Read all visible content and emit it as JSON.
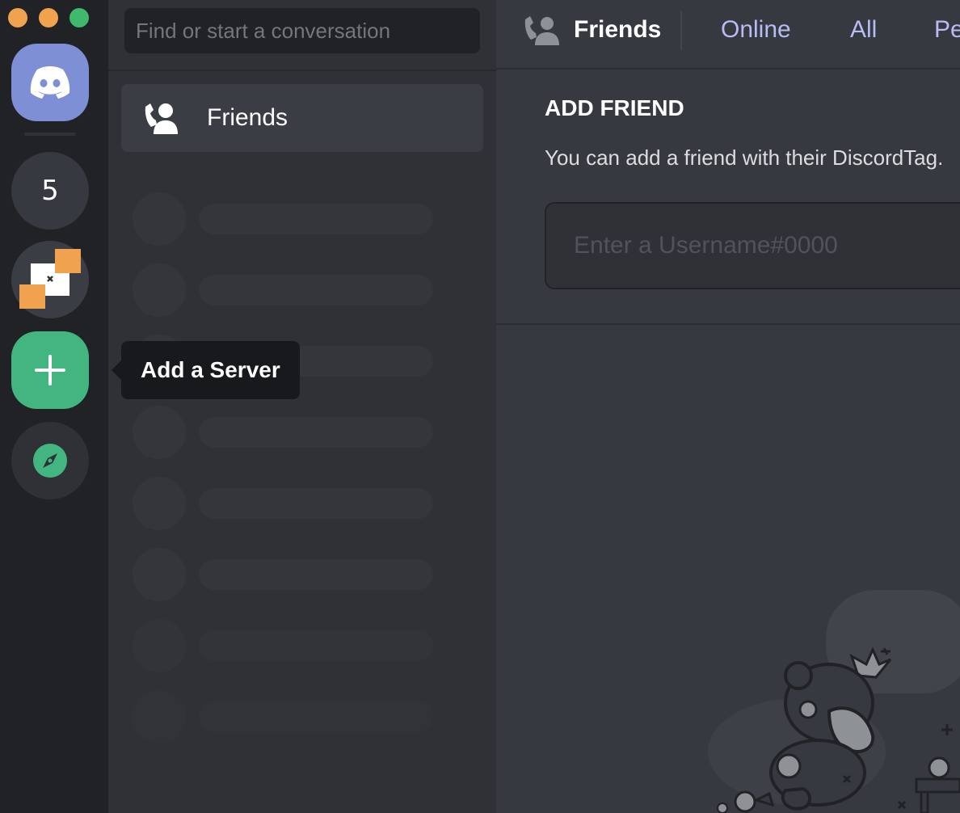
{
  "window": {
    "controls": [
      "close",
      "minimize",
      "zoom"
    ]
  },
  "server_rail": {
    "home_icon": "discord-logo-icon",
    "unread_count": "5",
    "tooltip": "Add a Server"
  },
  "sidebar": {
    "search_placeholder": "Find or start a conversation",
    "friends_label": "Friends"
  },
  "header": {
    "title": "Friends",
    "tabs": [
      "Online",
      "All",
      "Pe"
    ]
  },
  "add_friend": {
    "title": "ADD FRIEND",
    "description": "You can add a friend with their DiscordTag.",
    "input_placeholder": "Enter a Username#0000"
  },
  "colors": {
    "rail_bg": "#202225",
    "sidebar_bg": "#2f3136",
    "main_bg": "#36393f",
    "blurple": "#7f8fd6",
    "green": "#43b581",
    "traffic_orange": "#f0a24f",
    "traffic_green": "#3fb96b"
  }
}
